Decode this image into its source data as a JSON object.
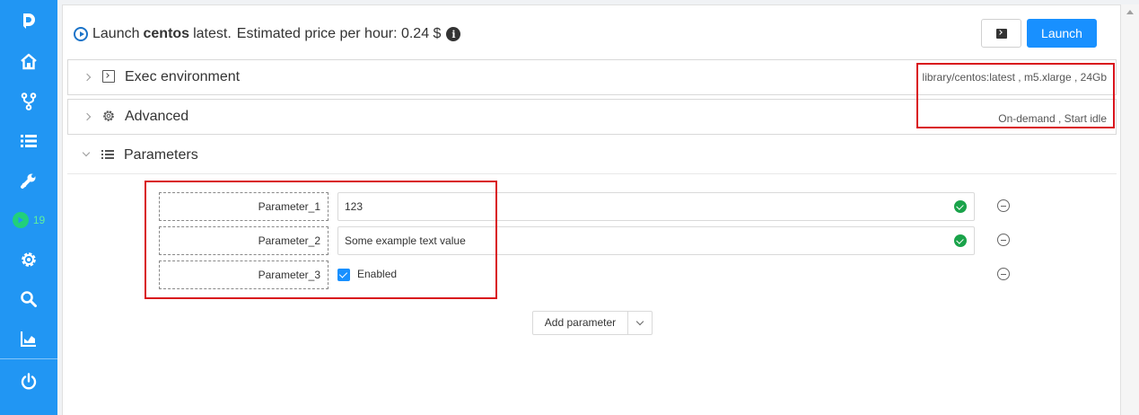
{
  "colors": {
    "sidebar": "#2196f3",
    "primary": "#1890ff",
    "runs_badge": "#21d07a",
    "valid": "#1aa34a",
    "highlight": "#d9141c"
  },
  "sidebar": {
    "items": [
      {
        "icon": "logo-icon"
      },
      {
        "icon": "home-icon"
      },
      {
        "icon": "pipelines-icon"
      },
      {
        "icon": "library-icon"
      },
      {
        "icon": "tools-icon"
      },
      {
        "icon": "runs-icon",
        "badge": "19"
      },
      {
        "icon": "settings-icon"
      },
      {
        "icon": "search-icon"
      },
      {
        "icon": "dashboard-icon"
      },
      {
        "icon": "logout-icon"
      }
    ]
  },
  "header": {
    "prefix": "Launch",
    "tool_name": "centos",
    "version": "latest.",
    "price_text": "Estimated price per hour: 0.24 $",
    "info_icon": "i",
    "launch_button": "Launch"
  },
  "sections": {
    "exec": {
      "title": "Exec environment",
      "summary": [
        "library/centos:latest",
        "m5.xlarge",
        "24Gb"
      ]
    },
    "advanced": {
      "title": "Advanced",
      "summary": [
        "On-demand",
        "Start idle"
      ]
    },
    "parameters": {
      "title": "Parameters",
      "items": [
        {
          "name": "Parameter_1",
          "value": "123"
        },
        {
          "name": "Parameter_2",
          "value": "Some example text value"
        },
        {
          "name": "Parameter_3",
          "checkbox_label": "Enabled",
          "checked": true
        }
      ],
      "add_button": "Add parameter"
    }
  }
}
